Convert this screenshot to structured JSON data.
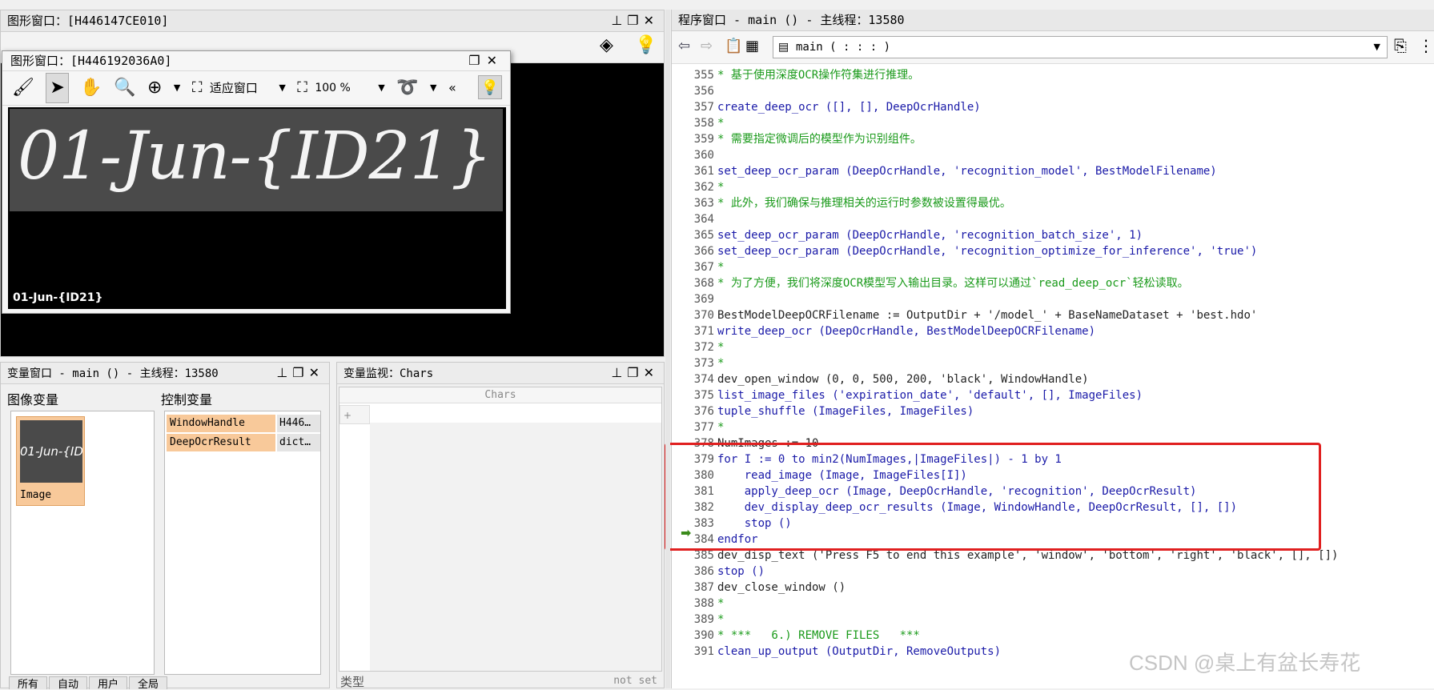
{
  "graphics_window": {
    "title": "图形窗口：[H446147CE010]",
    "fit_label": "适应窗口",
    "zoom": "100 %"
  },
  "floating_graphics": {
    "title": "图形窗口：[H446192036A0]",
    "fit_label": "适应窗口",
    "zoom": "100 %",
    "image_text": "01-Jun-{ID21}",
    "ocr_label": "01-Jun-{ID21}"
  },
  "variable_window": {
    "title": "变量窗口 - main () - 主线程：13580",
    "image_vars_header": "图像变量",
    "control_vars_header": "控制变量",
    "image_item_label": "Image",
    "control_vars": [
      {
        "name": "WindowHandle",
        "value": "H446…"
      },
      {
        "name": "DeepOcrResult",
        "value": "dict…"
      }
    ],
    "bottom_tabs": [
      "所有",
      "自动",
      "用户",
      "全局"
    ]
  },
  "monitor_window": {
    "title": "变量监视：Chars",
    "column_header": "Chars",
    "row_plus": "+",
    "type_label": "类型",
    "status": "not set"
  },
  "program_window": {
    "title": "程序窗口 - main () - 主线程：13580",
    "procedure": "main ( : : : )",
    "highlight_color": "#e02020",
    "lines": [
      {
        "n": "355",
        "t": "* 基于使用深度OCR操作符集进行推理。",
        "k": "comment"
      },
      {
        "n": "356",
        "t": "",
        "k": "plain"
      },
      {
        "n": "357",
        "t": "create_deep_ocr ([], [], DeepOcrHandle)",
        "k": "op"
      },
      {
        "n": "358",
        "t": "*",
        "k": "comment"
      },
      {
        "n": "359",
        "t": "* 需要指定微调后的模型作为识别组件。",
        "k": "comment"
      },
      {
        "n": "360",
        "t": "",
        "k": "plain"
      },
      {
        "n": "361",
        "t": "set_deep_ocr_param (DeepOcrHandle, 'recognition_model', BestModelFilename)",
        "k": "op"
      },
      {
        "n": "362",
        "t": "*",
        "k": "comment"
      },
      {
        "n": "363",
        "t": "* 此外，我们确保与推理相关的运行时参数被设置得最优。",
        "k": "comment"
      },
      {
        "n": "364",
        "t": "",
        "k": "plain"
      },
      {
        "n": "365",
        "t": "set_deep_ocr_param (DeepOcrHandle, 'recognition_batch_size', 1)",
        "k": "op"
      },
      {
        "n": "366",
        "t": "set_deep_ocr_param (DeepOcrHandle, 'recognition_optimize_for_inference', 'true')",
        "k": "op"
      },
      {
        "n": "367",
        "t": "*",
        "k": "comment"
      },
      {
        "n": "368",
        "t": "* 为了方便，我们将深度OCR模型写入输出目录。这样可以通过`read_deep_ocr`轻松读取。",
        "k": "comment"
      },
      {
        "n": "369",
        "t": "",
        "k": "plain"
      },
      {
        "n": "370",
        "t": "BestModelDeepOCRFilename := OutputDir + '/model_' + BaseNameDataset + 'best.hdo'",
        "k": "plain"
      },
      {
        "n": "371",
        "t": "write_deep_ocr (DeepOcrHandle, BestModelDeepOCRFilename)",
        "k": "op"
      },
      {
        "n": "372",
        "t": "*",
        "k": "comment"
      },
      {
        "n": "373",
        "t": "*",
        "k": "comment"
      },
      {
        "n": "374",
        "t": "dev_open_window (0, 0, 500, 200, 'black', WindowHandle)",
        "k": "plain"
      },
      {
        "n": "375",
        "t": "list_image_files ('expiration_date', 'default', [], ImageFiles)",
        "k": "op"
      },
      {
        "n": "376",
        "t": "tuple_shuffle (ImageFiles, ImageFiles)",
        "k": "op"
      },
      {
        "n": "377",
        "t": "*",
        "k": "comment"
      },
      {
        "n": "378",
        "t": "NumImages := 10",
        "k": "plain"
      },
      {
        "n": "379",
        "t": "for I := 0 to min2(NumImages,|ImageFiles|) - 1 by 1",
        "k": "ctrl"
      },
      {
        "n": "380",
        "t": "    read_image (Image, ImageFiles[I])",
        "k": "op"
      },
      {
        "n": "381",
        "t": "    apply_deep_ocr (Image, DeepOcrHandle, 'recognition', DeepOcrResult)",
        "k": "op"
      },
      {
        "n": "382",
        "t": "    dev_display_deep_ocr_results (Image, WindowHandle, DeepOcrResult, [], [])",
        "k": "op"
      },
      {
        "n": "383",
        "t": "    stop ()",
        "k": "ctrl"
      },
      {
        "n": "384",
        "t": "endfor",
        "k": "ctrl"
      },
      {
        "n": "385",
        "t": "dev_disp_text ('Press F5 to end this example', 'window', 'bottom', 'right', 'black', [], [])",
        "k": "plain"
      },
      {
        "n": "386",
        "t": "stop ()",
        "k": "ctrl"
      },
      {
        "n": "387",
        "t": "dev_close_window ()",
        "k": "plain"
      },
      {
        "n": "388",
        "t": "*",
        "k": "comment"
      },
      {
        "n": "389",
        "t": "*",
        "k": "comment"
      },
      {
        "n": "390",
        "t": "* ***   6.) REMOVE FILES   ***",
        "k": "comment"
      },
      {
        "n": "391",
        "t": "clean_up_output (OutputDir, RemoveOutputs)",
        "k": "op"
      }
    ]
  },
  "watermark": "CSDN @桌上有盆长寿花"
}
